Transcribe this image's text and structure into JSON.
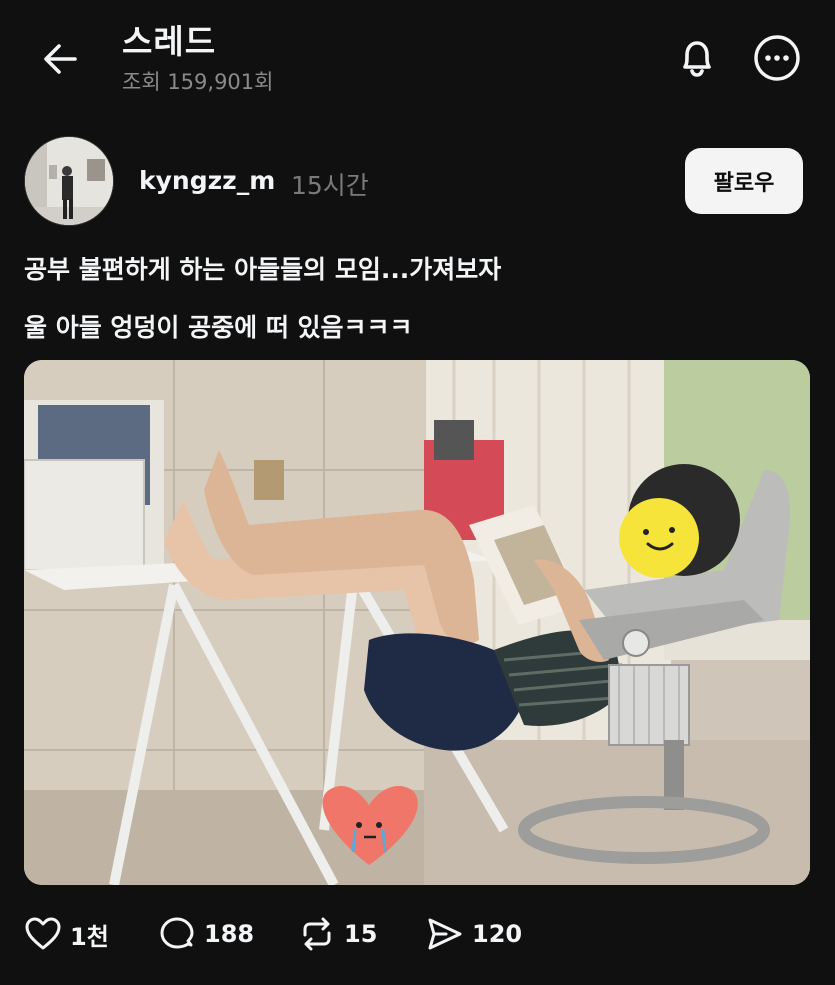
{
  "header": {
    "title": "스레드",
    "views": "조회 159,901회"
  },
  "post": {
    "username": "kyngzz_m",
    "time_ago": "15시간",
    "follow_label": "팔로우",
    "text_line1": "공부 불편하게 하는 아들들의 모임...가져보자",
    "text_line2": "울 아들 엉덩이 공중에 떠 있음ㅋㅋㅋ"
  },
  "actions": {
    "likes": "1천",
    "comments": "188",
    "reposts": "15",
    "shares": "120"
  },
  "icons": {
    "back": "arrow-left-icon",
    "bell": "bell-icon",
    "more": "more-icon",
    "like": "heart-icon",
    "comment": "comment-icon",
    "repost": "repost-icon",
    "share": "send-icon"
  },
  "colors": {
    "background": "#101010",
    "text": "#f3f5f7",
    "muted": "#8a8a8a",
    "follow_bg": "#f4f4f4"
  }
}
